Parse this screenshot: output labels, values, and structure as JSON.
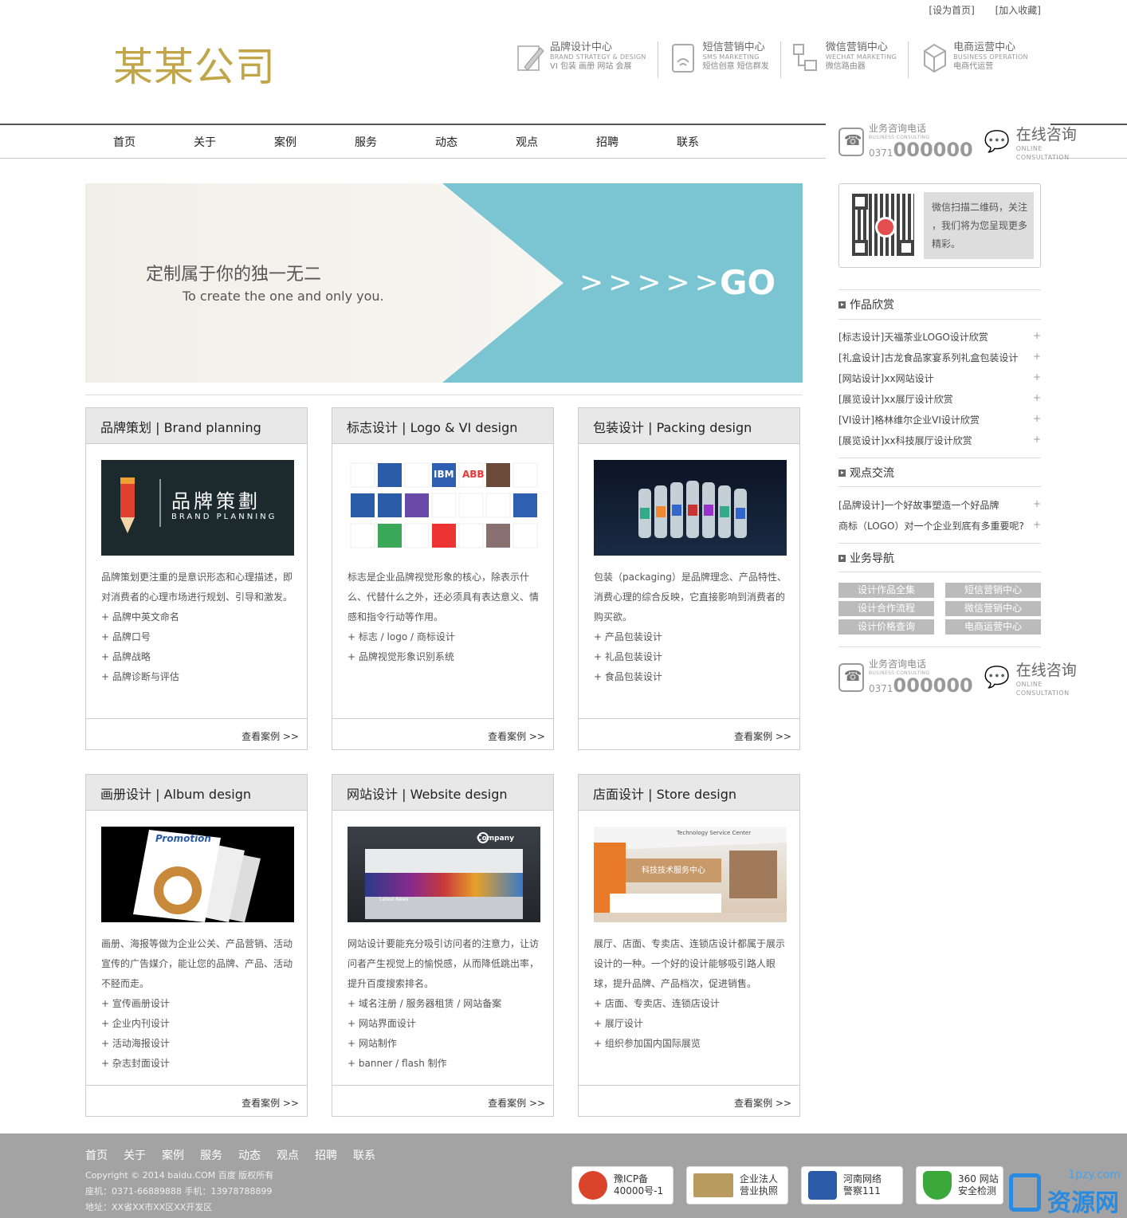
{
  "header": {
    "top_links": [
      "[设为首页]",
      "[加入收藏]"
    ],
    "logo": "某某公司",
    "centers": [
      {
        "title": "品牌设计中心",
        "en": "BRAND STRATEGY & DESIGN",
        "sub": "VI 包装 画册 网站 会展",
        "icon": "pencil-icon"
      },
      {
        "title": "短信营销中心",
        "en": "SMS MARKETING",
        "sub": "短信创意 短信群发",
        "icon": "phone-sms-icon"
      },
      {
        "title": "微信营销中心",
        "en": "WECHAT MARKETING",
        "sub": "微信路由器",
        "icon": "network-icon"
      },
      {
        "title": "电商运营中心",
        "en": "BUSINESS OPERATION",
        "sub": "电商代运营",
        "icon": "cube-icon"
      }
    ]
  },
  "nav": [
    "首页",
    "关于",
    "案例",
    "服务",
    "动态",
    "观点",
    "招聘",
    "联系"
  ],
  "contact": {
    "label": "业务咨询电话",
    "label_en": "BUSINESS CONSULTING",
    "area": "0371",
    "number": "000000",
    "online": "在线咨询",
    "online_en1": "ONLINE",
    "online_en2": "CONSULTATION"
  },
  "qr": {
    "text": "微信扫描二维码，关注 ，我们将为您呈现更多精彩。"
  },
  "banner": {
    "cn": "定制属于你的独一无二",
    "en": "To create the one and only you.",
    "arrows": ">>>>>",
    "go": "GO"
  },
  "sidebar": {
    "works_title": "作品欣赏",
    "works": [
      "[标志设计]天福茶业LOGO设计欣赏",
      "[礼盒设计]古龙食品家宴系列礼盒包装设计",
      "[网站设计]xx网站设计",
      "[展览设计]xx展厅设计欣赏",
      "[VI设计]格林维尔企业VI设计欣赏",
      "[展览设计]xx科技展厅设计欣赏"
    ],
    "views_title": "观点交流",
    "views": [
      "[品牌设计]一个好故事塑造一个好品牌",
      "商标（LOGO）对一个企业到底有多重要呢?"
    ],
    "biz_title": "业务导航",
    "biz_buttons": [
      "设计作品全集",
      "短信营销中心",
      "设计合作流程",
      "微信营销中心",
      "设计价格查询",
      "电商运营中心"
    ],
    "plus": "+"
  },
  "cards": [
    {
      "title": "品牌策划 | Brand planning",
      "desc": " 品牌策划更注重的是意识形态和心理描述，即对消费者的心理市场进行规划、引导和激发。",
      "items": [
        "+ 品牌中英文命名",
        "+ 品牌口号",
        "+ 品牌战略",
        "+ 品牌诊断与评估"
      ],
      "img_text": "品牌策劃",
      "img_sub": "BRAND PLANNING"
    },
    {
      "title": "标志设计 | Logo & VI design",
      "desc": " 标志是企业品牌视觉形象的核心，除表示什么、代替什么之外，还必须具有表达意义、情感和指令行动等作用。",
      "items": [
        "+ 标志 / logo / 商标设计",
        "+ 品牌视觉形象识别系统"
      ],
      "img_text": "IBM",
      "img_sub": "ABB"
    },
    {
      "title": "包装设计 | Packing design",
      "desc": " 包装（packaging）是品牌理念、产品特性、消费心理的综合反映，它直接影响到消费者的购买欲。",
      "items": [
        "+ 产品包装设计",
        "+ 礼品包装设计",
        "+ 食品包装设计"
      ],
      "img_text": "",
      "img_sub": ""
    },
    {
      "title": "画册设计 | Album design",
      "desc": " 画册、海报等做为企业公关、产品营销、活动宣传的广告媒介，能让您的品牌、产品、活动不胫而走。",
      "items": [
        "+ 宣传画册设计",
        "+ 企业内刊设计",
        "+ 活动海报设计",
        "+ 杂志封面设计"
      ],
      "img_text": "Promotion",
      "img_sub": ""
    },
    {
      "title": "网站设计 | Website design",
      "desc": " 网站设计要能充分吸引访问者的注意力，让访问者产生视觉上的愉悦感，从而降低跳出率，提升百度搜索排名。",
      "items": [
        "+ 域名注册 / 服务器租赁 / 网站备案",
        "+ 网站界面设计",
        "+ 网站制作",
        "+ banner / flash 制作"
      ],
      "img_text": "Company",
      "img_sub": "Latest News"
    },
    {
      "title": "店面设计 | Store design",
      "desc": "展厅、店面、专卖店、连锁店设计都属于展示设计的一种。一个好的设计能够吸引路人眼球，提升品牌、产品档次，促进销售。",
      "items": [
        "+ 店面、专卖店、连锁店设计",
        "+ 展厅设计",
        "+ 组织参加国内国际展览"
      ],
      "img_text": "科技技术服务中心",
      "img_sub": "Technology Service Center"
    }
  ],
  "card_more": "查看案例 >>",
  "footer": {
    "nav": [
      "首页",
      "关于",
      "案例",
      "服务",
      "动态",
      "观点",
      "招聘",
      "联系"
    ],
    "copyright": "Copyright © 2014 baidu.COM 百度 版权所有",
    "phone": "座机：0371-66889888 手机：13978788899",
    "address": "地址：XX省XX市XX区XX开发区",
    "badges": [
      {
        "l1": "豫ICP备",
        "l2": "40000号-1",
        "color": "#d9442b"
      },
      {
        "l1": "企业法人",
        "l2": "营业执照",
        "color": "#b99b60"
      },
      {
        "l1": "河南网络",
        "l2": "警察111",
        "color": "#2a5aa8"
      },
      {
        "l1": "360 网站",
        "l2": "安全检测",
        "color": "#3aa83a"
      }
    ],
    "watermark_url": "1pzy.com",
    "watermark": "资源网"
  },
  "colors": {
    "logo": "#c1a649",
    "banner_blue": "#7bc5d2",
    "footer": "#a3a3a3"
  }
}
